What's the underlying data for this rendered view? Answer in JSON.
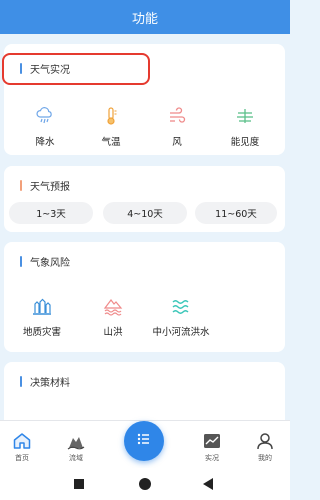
{
  "header": {
    "title": "功能"
  },
  "weather_live": {
    "title": "天气实况",
    "accent": "#4a90e2",
    "items": [
      {
        "label": "降水",
        "icon": "rain-cloud-icon"
      },
      {
        "label": "气温",
        "icon": "thermometer-icon"
      },
      {
        "label": "风",
        "icon": "wind-icon"
      },
      {
        "label": "能见度",
        "icon": "visibility-icon"
      }
    ]
  },
  "forecast": {
    "title": "天气预报",
    "accent": "#f2a07a",
    "ranges": [
      "1~3天",
      "4~10天",
      "11~60天"
    ]
  },
  "meteo_risk": {
    "title": "气象风险",
    "accent": "#4a90e2",
    "items": [
      {
        "label": "地质灾害",
        "icon": "landslide-icon"
      },
      {
        "label": "山洪",
        "icon": "flash-flood-icon"
      },
      {
        "label": "中小河流洪水",
        "icon": "river-flood-icon"
      }
    ]
  },
  "decision": {
    "title": "决策材料",
    "accent": "#4a90e2"
  },
  "tabbar": {
    "items": [
      {
        "label": "首页",
        "icon": "home-icon"
      },
      {
        "label": "流域",
        "icon": "basin-icon"
      },
      {
        "label": "实况",
        "icon": "chart-icon"
      },
      {
        "label": "我的",
        "icon": "user-icon"
      }
    ],
    "center_icon": "menu-icon"
  },
  "system_nav": {
    "icons": [
      "recent-apps-icon",
      "home-circle-icon",
      "back-icon"
    ]
  }
}
